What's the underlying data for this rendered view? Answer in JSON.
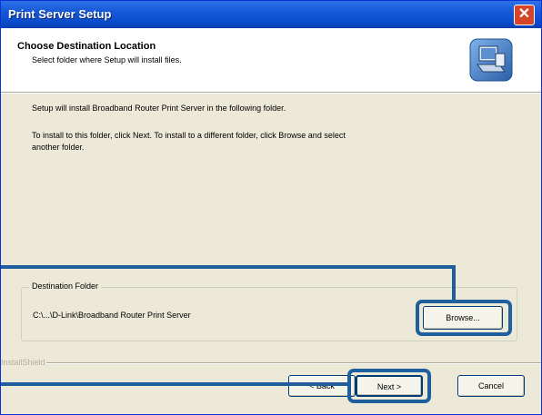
{
  "window": {
    "title": "Print Server Setup",
    "close_glyph": "✕"
  },
  "header": {
    "title": "Choose Destination Location",
    "subtitle": "Select folder where Setup will install files.",
    "logo_icon": "setup-computer-icon"
  },
  "body": {
    "line1": "Setup will install Broadband Router Print Server in the following folder.",
    "line2": "To install to this folder, click Next. To install to a different folder, click Browse and select",
    "line3": "another folder."
  },
  "destination": {
    "legend": "Destination Folder",
    "path": "C:\\...\\D-Link\\Broadband Router Print Server",
    "browse_label": "Browse..."
  },
  "footer": {
    "installshield_text": "InstallShield",
    "back_label": "< Back",
    "next_label": "Next >",
    "cancel_label": "Cancel"
  },
  "colors": {
    "titlebar": "#0a4bc9",
    "dialog_bg": "#ece9d8",
    "callout": "#1f5f9e",
    "close_button": "#d6452a"
  }
}
